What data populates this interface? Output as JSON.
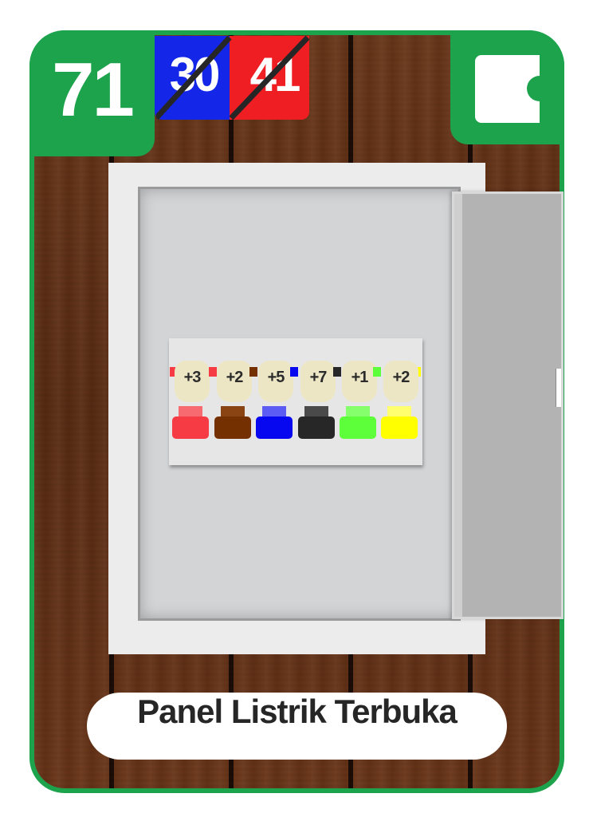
{
  "card": {
    "score": "71",
    "split_left": "30",
    "split_right": "41",
    "title": "Panel Listrik Terbuka"
  },
  "colors": {
    "card_green": "#1ea34d",
    "split_blue": "#1427e8",
    "split_red": "#ee1e23"
  },
  "breakers": [
    {
      "label": "+3",
      "color": "red",
      "base": "#f73b45",
      "neck": "#f76a70",
      "wire": "#f73b45"
    },
    {
      "label": "+2",
      "color": "brown",
      "base": "#743000",
      "neck": "#8a4413",
      "wire": "#743000"
    },
    {
      "label": "+5",
      "color": "blue",
      "base": "#0707f0",
      "neck": "#5c5cf5",
      "wire": "#0707f0"
    },
    {
      "label": "+7",
      "color": "black",
      "base": "#272727",
      "neck": "#4a4a4a",
      "wire": "#272727"
    },
    {
      "label": "+1",
      "color": "green",
      "base": "#5cff39",
      "neck": "#86ff6d",
      "wire": "#5cff39"
    },
    {
      "label": "+2",
      "color": "yellow",
      "base": "#ffff00",
      "neck": "#ffff70",
      "wire": "#ffff00"
    }
  ]
}
